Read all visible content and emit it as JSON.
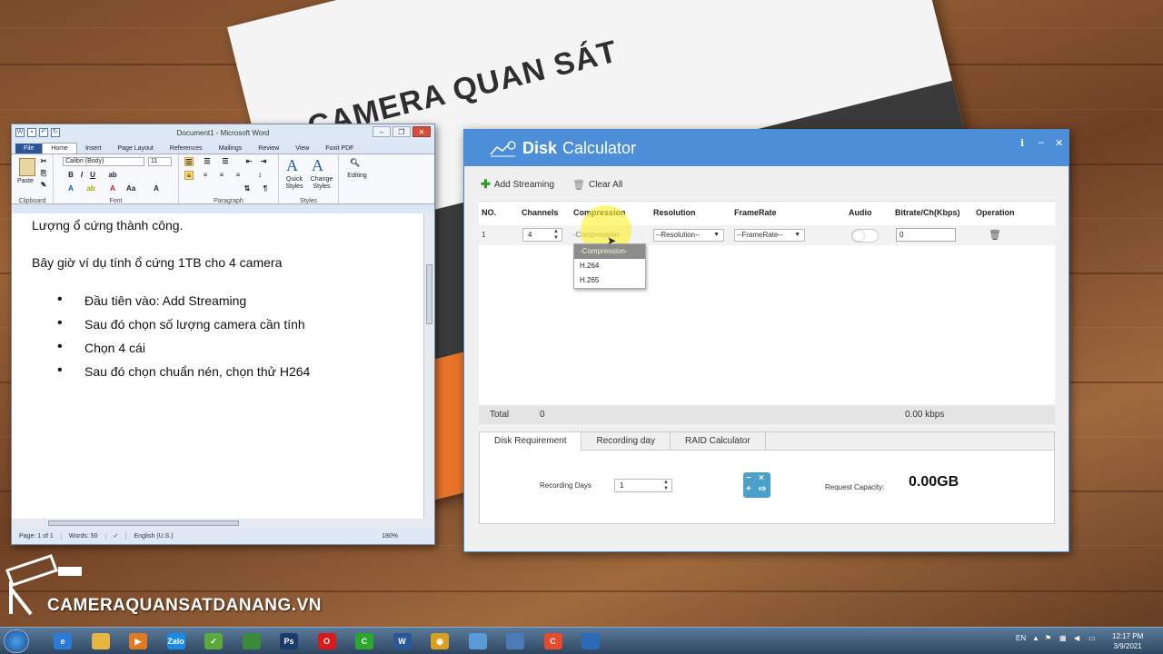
{
  "paper": {
    "title": "CAMERA QUAN SÁT"
  },
  "word": {
    "title": "Document1 - Microsoft Word",
    "tabs": [
      "File",
      "Home",
      "Insert",
      "Page Layout",
      "References",
      "Mailings",
      "Review",
      "View",
      "Foxit PDF"
    ],
    "ribbon": {
      "font_name": "Calibri (Body)",
      "font_size": "11",
      "paste_label": "Paste",
      "groups": [
        "Clipboard",
        "Font",
        "Paragraph",
        "Styles"
      ],
      "quick_styles": "Quick Styles",
      "change_styles": "Change Styles",
      "editing": "Editing"
    },
    "doc": {
      "line1": "Lượng ổ cứng thành công.",
      "line2": "Bây giờ ví dụ tính ổ cứng 1TB cho 4 camera",
      "bullets": [
        "Đầu tiên vào: Add Streaming",
        "Sau đó chọn số lượng camera cần tính",
        "Chọn 4 cái",
        "Sau đó chọn chuẩn nén, chọn thử H264"
      ]
    },
    "status": {
      "page": "Page: 1 of 1",
      "words": "Words: 50",
      "lang": "English (U.S.)",
      "zoom": "180%"
    }
  },
  "disk": {
    "title_bold": "Disk",
    "title_rest": "Calculator",
    "toolbar": {
      "add": "Add Streaming",
      "clear": "Clear All"
    },
    "headers": [
      "NO.",
      "Channels",
      "Compression",
      "Resolution",
      "FrameRate",
      "Audio",
      "Bitrate/Ch(Kbps)",
      "Operation"
    ],
    "row": {
      "no": "1",
      "channels": "4",
      "compression": "-Compression-",
      "resolution": "--Resolution--",
      "framerate": "--FrameRate--",
      "bitrate": "0"
    },
    "dropdown": [
      "-Compression-",
      "H.264",
      "H.265"
    ],
    "total": {
      "label": "Total",
      "count": "0",
      "kbps": "0.00 kbps"
    },
    "tabs": [
      "Disk Requirement",
      "Recording day",
      "RAID Calculator"
    ],
    "recording_days_label": "Recording Days",
    "recording_days_value": "1",
    "capacity_label": "Request Capacity:",
    "capacity_value": "0.00GB"
  },
  "watermark": {
    "text": "CAMERAQUANSATDANANG.VN"
  },
  "taskbar": {
    "lang": "EN",
    "time": "12:17 PM",
    "date": "3/9/2021",
    "apps": [
      {
        "name": "ie",
        "label": "e",
        "color": "#2a7ad8"
      },
      {
        "name": "explorer",
        "label": "",
        "color": "#e8b640"
      },
      {
        "name": "media",
        "label": "▶",
        "color": "#e07a20"
      },
      {
        "name": "zalo",
        "label": "Zalo",
        "color": "#1a8ae8"
      },
      {
        "name": "pdf",
        "label": "✓",
        "color": "#5aaa3a"
      },
      {
        "name": "app",
        "label": "",
        "color": "#3a8a3a"
      },
      {
        "name": "photoshop",
        "label": "Ps",
        "color": "#1a3c6a"
      },
      {
        "name": "opera",
        "label": "O",
        "color": "#d81a1a"
      },
      {
        "name": "camtasia",
        "label": "C",
        "color": "#2aa82a"
      },
      {
        "name": "word",
        "label": "W",
        "color": "#2b579a"
      },
      {
        "name": "chrome",
        "label": "◉",
        "color": "#d8a020"
      },
      {
        "name": "notes",
        "label": "",
        "color": "#5a9ad8"
      },
      {
        "name": "window",
        "label": "",
        "color": "#4a7ab8"
      },
      {
        "name": "recorder",
        "label": "C",
        "color": "#e84a2a"
      },
      {
        "name": "calc",
        "label": "",
        "color": "#2a6ab8"
      }
    ]
  }
}
